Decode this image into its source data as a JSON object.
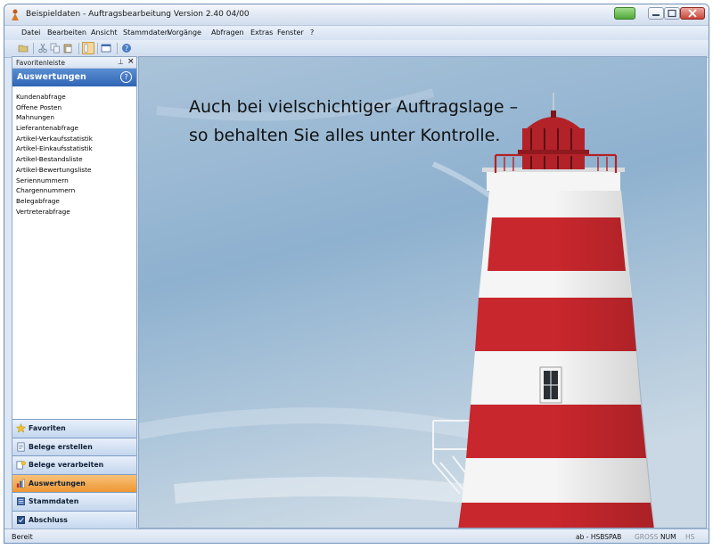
{
  "window": {
    "title": "Beispieldaten - Auftragsbearbeitung Version 2.40 04/00"
  },
  "menu": [
    "Datei",
    "Bearbeiten",
    "Ansicht",
    "Stammdaten",
    "Vorgänge",
    "Abfragen",
    "Extras",
    "Fenster",
    "?"
  ],
  "sidebar": {
    "header": "Favoritenleiste",
    "section_title": "Auswertungen",
    "reports": [
      "Kundenabfrage",
      "Offene Posten",
      "Mahnungen",
      "Lieferantenabfrage",
      "Artikel-Verkaufsstatistik",
      "Artikel-Einkaufsstatistik",
      "Artikel-Bestandsliste",
      "Artikel-Bewertungsliste",
      "Seriennummern",
      "Chargennummern",
      "Belegabfrage",
      "Vertreterabfrage"
    ],
    "nav": [
      {
        "label": "Favoriten",
        "icon": "star-icon"
      },
      {
        "label": "Belege erstellen",
        "icon": "document-new-icon"
      },
      {
        "label": "Belege verarbeiten",
        "icon": "document-process-icon"
      },
      {
        "label": "Auswertungen",
        "icon": "report-icon",
        "active": true
      },
      {
        "label": "Stammdaten",
        "icon": "database-icon"
      },
      {
        "label": "Abschluss",
        "icon": "closing-icon"
      }
    ]
  },
  "content": {
    "headline_line1": "Auch bei vielschichtiger Auftragslage –",
    "headline_line2": "so behalten Sie alles unter Kontrolle."
  },
  "status": {
    "left": "Bereit",
    "user": "ab - HSBSPAB",
    "gross": "GROSS",
    "num": "NUM",
    "hs": "HS"
  },
  "colors": {
    "accent": "#2f65b4",
    "active_nav": "#ee9732",
    "lighthouse_red": "#c8272d"
  }
}
